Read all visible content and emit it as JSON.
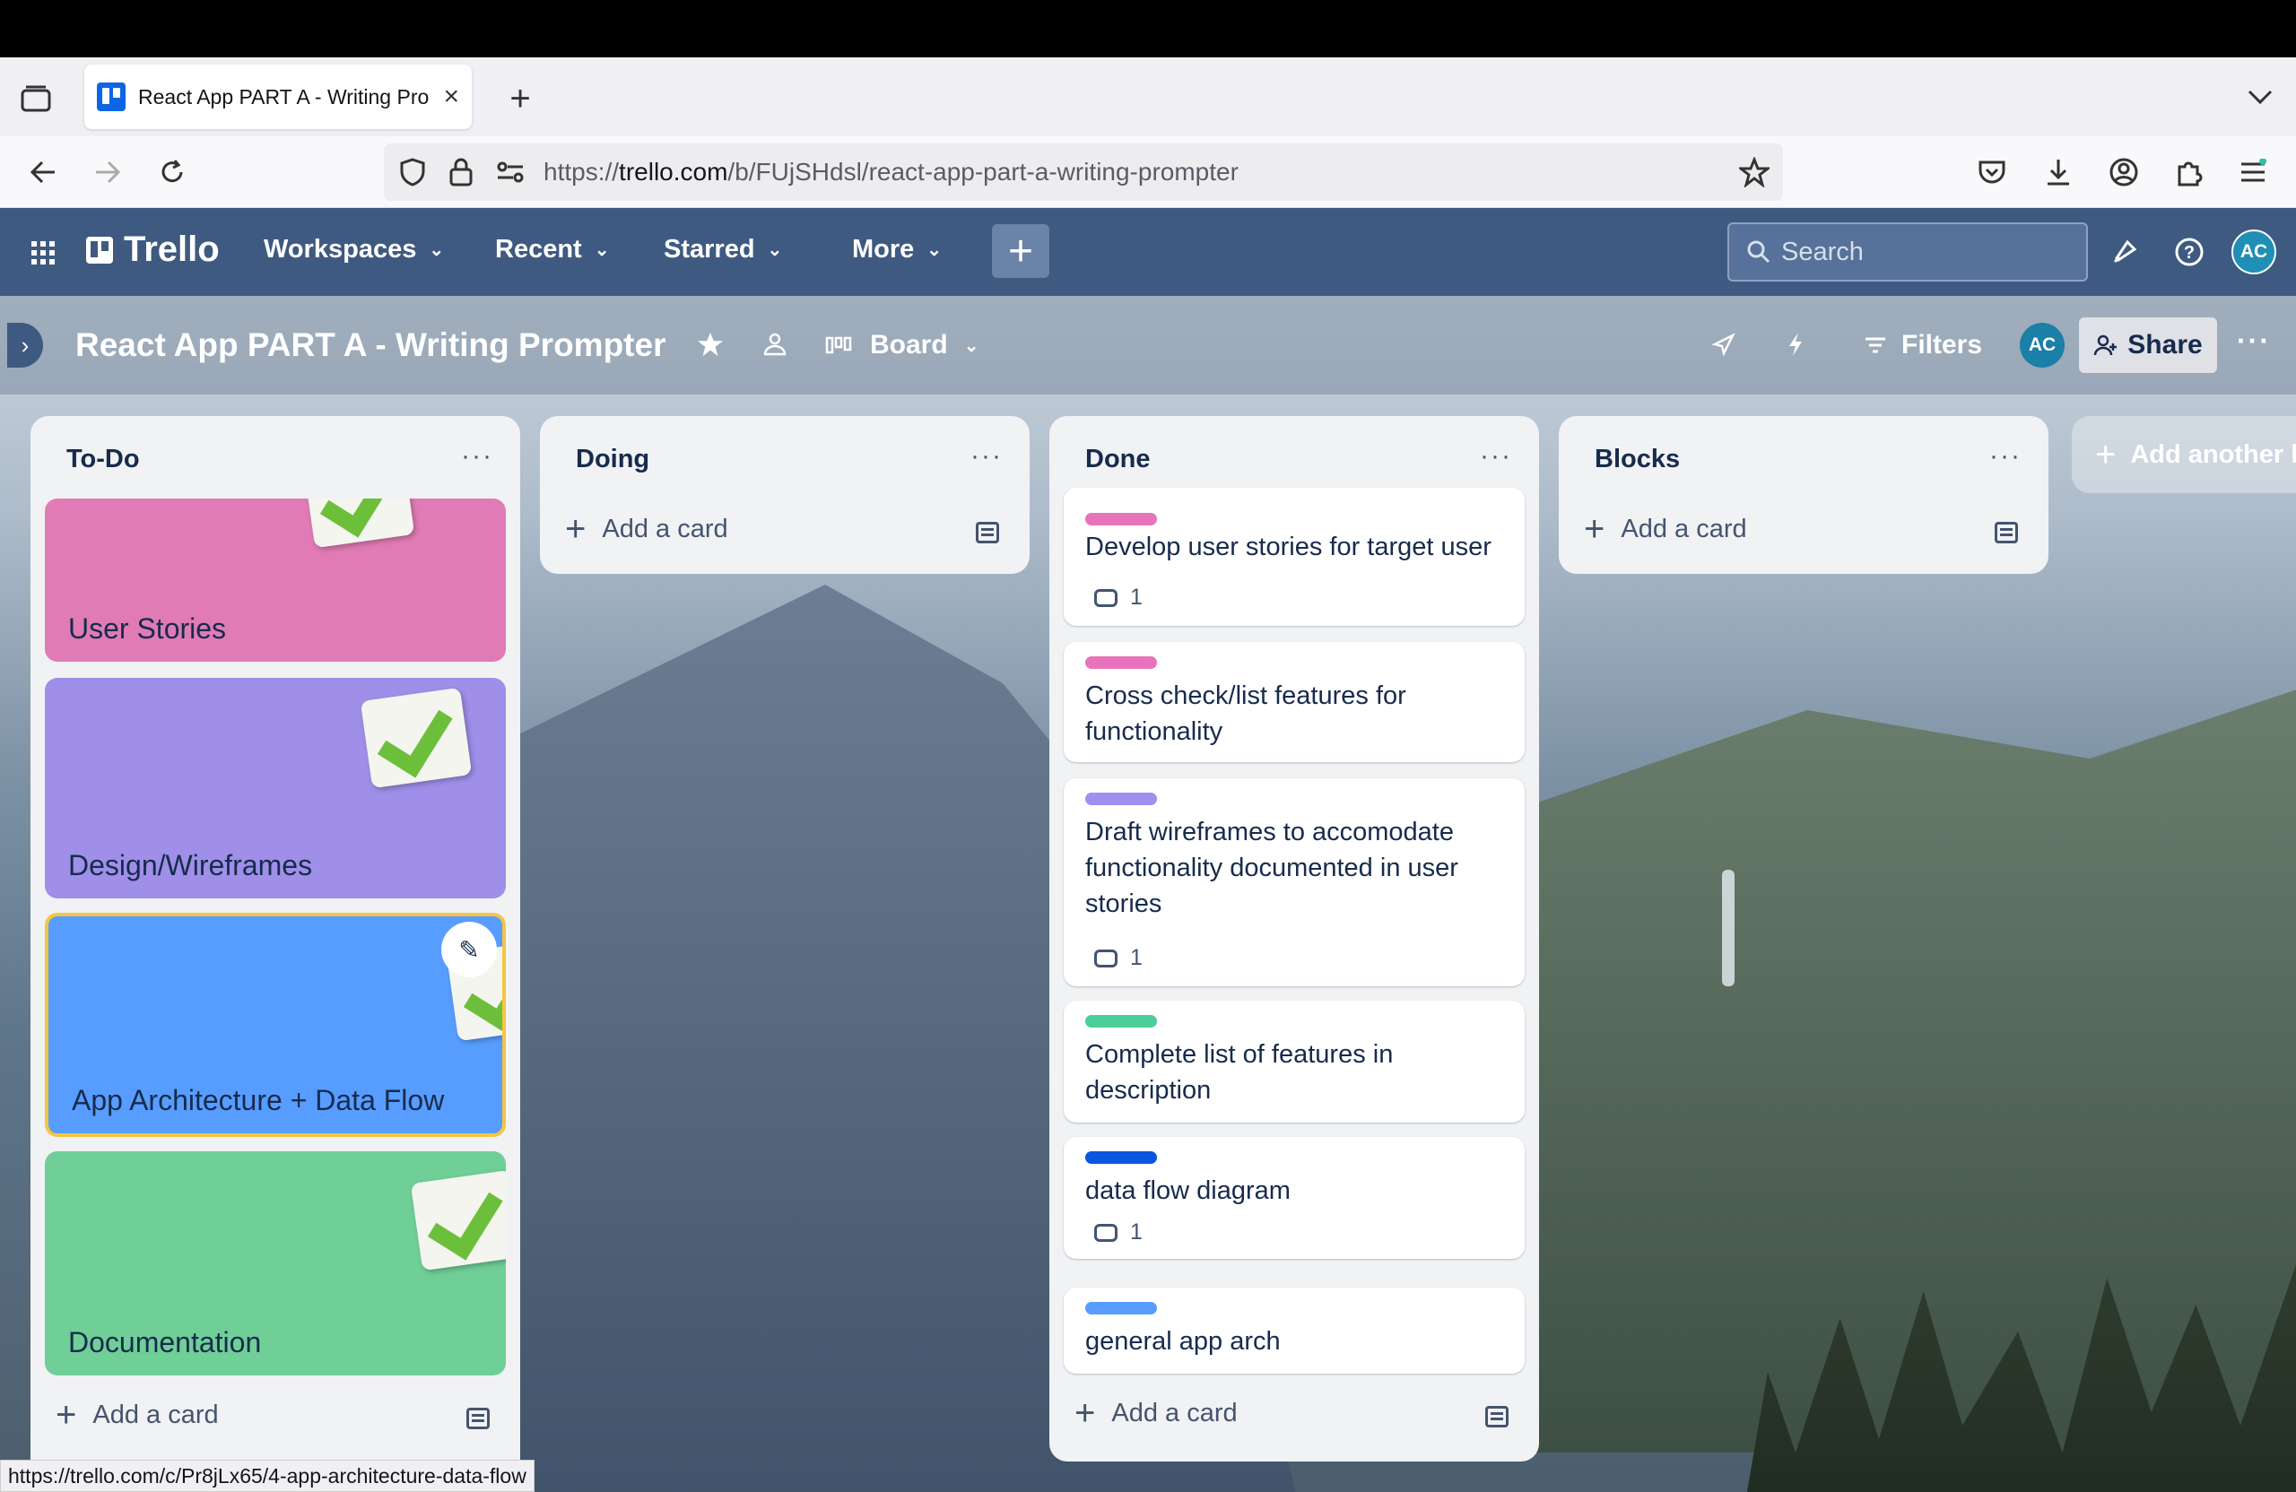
{
  "browser": {
    "tab_title": "React App PART A - Writing Pro",
    "url_prefix": "https://",
    "url_domain": "trello.com",
    "url_path": "/b/FUjSHdsl/react-app-part-a-writing-prompter",
    "status_url": "https://trello.com/c/Pr8jLx65/4-app-architecture-data-flow"
  },
  "nav": {
    "logo": "Trello",
    "workspaces": "Workspaces",
    "recent": "Recent",
    "starred": "Starred",
    "more": "More",
    "search_placeholder": "Search",
    "avatar": "AC"
  },
  "board": {
    "title": "React App PART A - Writing Prompter",
    "view": "Board",
    "filters": "Filters",
    "share": "Share",
    "avatar": "AC",
    "add_another": "Add another l"
  },
  "lists": {
    "todo": {
      "title": "To-Do",
      "add": "Add a card",
      "covers": [
        {
          "label": "User Stories",
          "color": "#e07bb6"
        },
        {
          "label": "Design/Wireframes",
          "color": "#9f8fe8"
        },
        {
          "label": "App Architecture + Data Flow",
          "color": "#579dff"
        },
        {
          "label": "Documentation",
          "color": "#6fcf97"
        }
      ]
    },
    "doing": {
      "title": "Doing",
      "add": "Add a card"
    },
    "done": {
      "title": "Done",
      "add": "Add a card",
      "cards": [
        {
          "text": "Develop user stories for target user",
          "label_color": "#e774bb",
          "comments": "1"
        },
        {
          "text": "Cross check/list features for functionality",
          "label_color": "#e774bb"
        },
        {
          "text": "Draft wireframes to accomodate functionality documented in user stories",
          "label_color": "#9f8fef",
          "comments": "1"
        },
        {
          "text": "Complete list of features in description",
          "label_color": "#4bce97"
        },
        {
          "text": "data flow diagram",
          "label_color": "#0c55e0",
          "comments": "1"
        },
        {
          "text": "general app arch",
          "label_color": "#579dff"
        }
      ]
    },
    "blocks": {
      "title": "Blocks",
      "add": "Add a card"
    }
  }
}
